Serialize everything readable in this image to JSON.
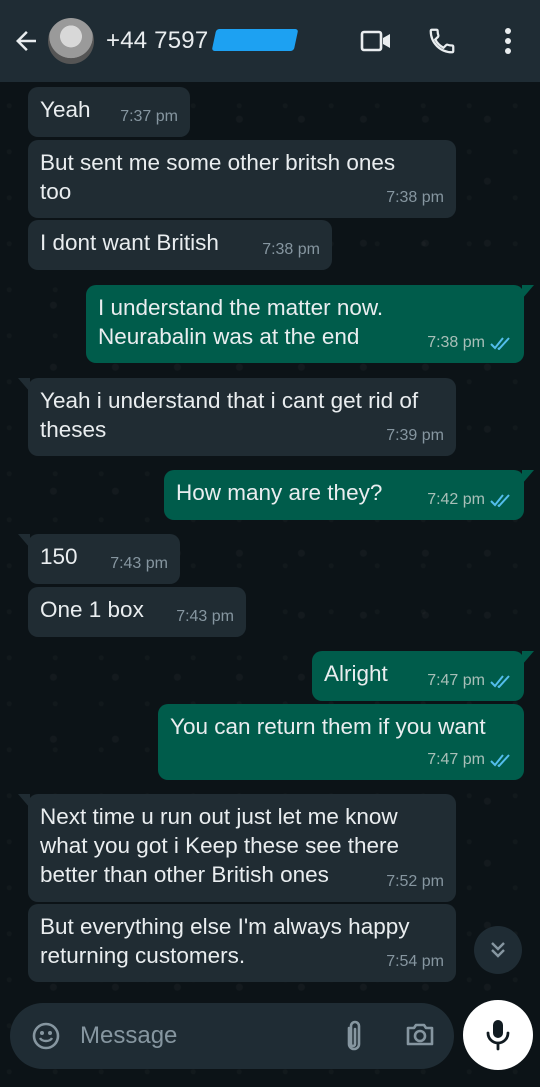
{
  "header": {
    "contact_name": "+44 7597",
    "icons": [
      "back-arrow-icon",
      "video-call-icon",
      "voice-call-icon",
      "more-options-icon"
    ]
  },
  "messages": [
    {
      "direction": "in",
      "text": "Yeah",
      "time": "7:37 pm"
    },
    {
      "direction": "in",
      "text": "But sent me some other britsh ones too",
      "time": "7:38 pm"
    },
    {
      "direction": "in",
      "text": "I dont want British",
      "time": "7:38 pm"
    },
    {
      "direction": "out",
      "text": "I understand the matter now. Neurabalin was at the end",
      "time": "7:38 pm",
      "status": "read"
    },
    {
      "direction": "in",
      "text": "Yeah i understand that i cant get rid of theses",
      "time": "7:39 pm"
    },
    {
      "direction": "out",
      "text": "How many are they?",
      "time": "7:42 pm",
      "status": "read"
    },
    {
      "direction": "in",
      "text": "150",
      "time": "7:43 pm"
    },
    {
      "direction": "in",
      "text": "One 1 box",
      "time": "7:43 pm"
    },
    {
      "direction": "out",
      "text": "Alright",
      "time": "7:47 pm",
      "status": "read"
    },
    {
      "direction": "out",
      "text": "You can return them if you want",
      "time": "7:47 pm",
      "status": "read"
    },
    {
      "direction": "in",
      "text": "Next time u run out just let me  know what you got i Keep these see there better than other British ones",
      "time": "7:52 pm"
    },
    {
      "direction": "in",
      "text": "But everything else I'm always happy returning customers.",
      "time": "7:54 pm"
    }
  ],
  "composer": {
    "placeholder": "Message"
  },
  "colors": {
    "header_bg": "#1f2c34",
    "incoming_bubble": "#202c33",
    "outgoing_bubble": "#005c4b",
    "read_ticks": "#53bdeb"
  }
}
